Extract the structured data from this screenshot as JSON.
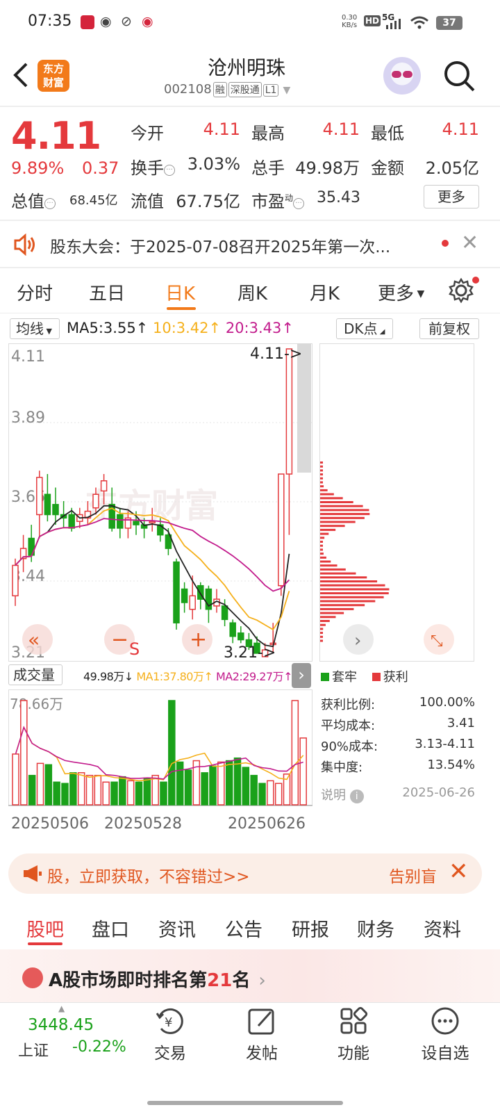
{
  "status_bar": {
    "time": "07:35",
    "net_speed": "0.30",
    "net_unit": "KB/s",
    "hd": "HD",
    "signal": "5G",
    "battery": "37"
  },
  "header": {
    "logo_text": "东方\n财富",
    "stock_name": "沧州明珠",
    "stock_code": "002108",
    "tags": [
      "融",
      "深股通",
      "L1"
    ]
  },
  "quote": {
    "price": "4.11",
    "change_pct": "9.89%",
    "change": "0.37",
    "total_cap_label": "总值",
    "total_cap": "68.45亿",
    "grid": [
      {
        "label": "今开",
        "value": "4.11",
        "color": "#e4393c"
      },
      {
        "label": "最高",
        "value": "4.11",
        "color": "#e4393c"
      },
      {
        "label": "最低",
        "value": "4.11",
        "color": "#e4393c"
      },
      {
        "label": "换手",
        "value": "3.03%",
        "color": "#333333"
      },
      {
        "label": "总手",
        "value": "49.98万",
        "color": "#333333"
      },
      {
        "label": "金额",
        "value": "2.05亿",
        "color": "#333333"
      },
      {
        "label": "流值",
        "value": "67.75亿",
        "color": "#333333"
      },
      {
        "label": "市盈",
        "value": "35.43",
        "color": "#333333"
      }
    ],
    "pe_superscript": "动",
    "more_label": "更多"
  },
  "notice": {
    "text": "股东大会：于2025-07-08召开2025年第一次..."
  },
  "kline_tabs": [
    "分时",
    "五日",
    "日K",
    "周K",
    "月K",
    "更多"
  ],
  "active_tab": "日K",
  "ma_bar": {
    "select_label": "均线",
    "ma5": "MA5:3.55↑",
    "ma10": "10:3.42↑",
    "ma20": "20:3.43↑",
    "dk_label": "DK点",
    "fq_label": "前复权"
  },
  "price_axis": [
    "4.11",
    "3.89",
    "3.66",
    "3.44",
    "3.21"
  ],
  "price_markers": {
    "high": "4.11->",
    "low": "3.21->"
  },
  "watermark": "东方财富",
  "chart_overlay": {
    "s_label": "S"
  },
  "volume": {
    "select_label": "成交量",
    "vol": "49.98万↓",
    "ma1": "MA1:37.80万↑",
    "ma2": "MA2:29.27万↑",
    "axis_max": "78.66万"
  },
  "dates": [
    "20250506",
    "20250528",
    "20250626"
  ],
  "chart_data": {
    "type": "candlestick",
    "ylim": [
      3.21,
      4.11
    ],
    "candles": [
      [
        3.38,
        3.47,
        3.49,
        3.35
      ],
      [
        3.49,
        3.52,
        3.56,
        3.45
      ],
      [
        3.55,
        3.5,
        3.59,
        3.48
      ],
      [
        3.62,
        3.73,
        3.75,
        3.55
      ],
      [
        3.68,
        3.62,
        3.74,
        3.6
      ],
      [
        3.65,
        3.62,
        3.7,
        3.59
      ],
      [
        3.62,
        3.61,
        3.66,
        3.58
      ],
      [
        3.62,
        3.58,
        3.64,
        3.57
      ],
      [
        3.6,
        3.62,
        3.64,
        3.58
      ],
      [
        3.61,
        3.63,
        3.66,
        3.59
      ],
      [
        3.64,
        3.68,
        3.7,
        3.62
      ],
      [
        3.69,
        3.72,
        3.74,
        3.65
      ],
      [
        3.65,
        3.58,
        3.7,
        3.57
      ],
      [
        3.62,
        3.58,
        3.64,
        3.55
      ],
      [
        3.58,
        3.61,
        3.63,
        3.55
      ],
      [
        3.6,
        3.59,
        3.63,
        3.56
      ],
      [
        3.59,
        3.58,
        3.61,
        3.55
      ],
      [
        3.6,
        3.6,
        3.64,
        3.57
      ],
      [
        3.59,
        3.56,
        3.61,
        3.54
      ],
      [
        3.56,
        3.52,
        3.58,
        3.5
      ],
      [
        3.48,
        3.3,
        3.49,
        3.28
      ],
      [
        3.4,
        3.36,
        3.42,
        3.33
      ],
      [
        3.34,
        3.38,
        3.44,
        3.31
      ],
      [
        3.41,
        3.37,
        3.42,
        3.34
      ],
      [
        3.4,
        3.34,
        3.41,
        3.3
      ],
      [
        3.35,
        3.37,
        3.4,
        3.33
      ],
      [
        3.35,
        3.31,
        3.37,
        3.29
      ],
      [
        3.3,
        3.26,
        3.31,
        3.24
      ],
      [
        3.27,
        3.25,
        3.29,
        3.24
      ],
      [
        3.25,
        3.23,
        3.27,
        3.22
      ],
      [
        3.24,
        3.21,
        3.26,
        3.21
      ],
      [
        3.2,
        3.22,
        3.24,
        3.21
      ],
      [
        3.24,
        3.24,
        3.3,
        3.21
      ],
      [
        3.41,
        3.74,
        3.74,
        3.38
      ],
      [
        3.74,
        4.11,
        4.11,
        3.56
      ]
    ],
    "volumes": [
      38,
      78,
      22,
      31,
      30,
      17,
      16,
      24,
      24,
      22,
      22,
      17,
      17,
      21,
      18,
      17,
      20,
      22,
      17,
      78,
      32,
      26,
      33,
      24,
      29,
      32,
      33,
      35,
      28,
      22,
      16,
      18,
      16,
      23,
      78,
      50
    ],
    "chip_legend": {
      "trapped": "套牢",
      "profit": "获利"
    }
  },
  "chip_stats": [
    {
      "label": "获利比例:",
      "value": "100.00%"
    },
    {
      "label": "平均成本:",
      "value": "3.41"
    },
    {
      "label": "90%成本:",
      "value": "3.13-4.11"
    },
    {
      "label": "集中度:",
      "value": "13.54%"
    }
  ],
  "chip_footer": {
    "label": "说明",
    "date": "2025-06-26"
  },
  "banner": {
    "text": "股，立即获取，不容错过>>",
    "right": "告别盲"
  },
  "bottom_tabs": [
    "股吧",
    "盘口",
    "资讯",
    "公告",
    "研报",
    "财务",
    "资料"
  ],
  "rank": {
    "prefix": "A股市场即时排名第",
    "number": "21",
    "suffix": "名"
  },
  "nav": {
    "index_value": "3448.45",
    "index_name": "上证",
    "index_change": "-0.22%",
    "items": [
      "交易",
      "发帖",
      "功能",
      "设自选"
    ]
  },
  "colors": {
    "up": "#e4393c",
    "down": "#1aa11a",
    "accent": "#f27a1a",
    "ma5": "#222222",
    "ma10": "#f5b01b",
    "ma20": "#c21b8c"
  }
}
